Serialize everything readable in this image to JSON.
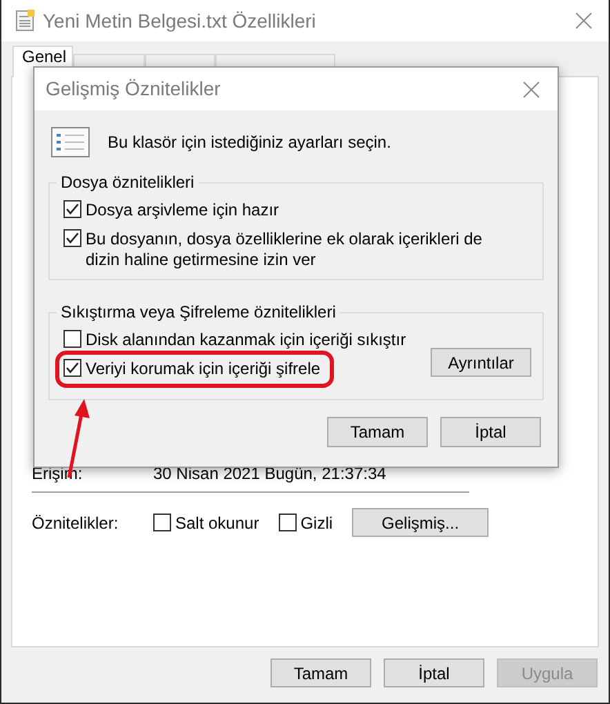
{
  "window": {
    "title": "Yeni Metin Belgesi.txt Özellikleri"
  },
  "tabs": [
    {
      "label": "Genel",
      "selected": true
    },
    {
      "selected": false
    },
    {
      "selected": false
    },
    {
      "selected": false
    }
  ],
  "general": {
    "rows": [
      {
        "label": "Erişim:",
        "value": "30 Nisan 2021 Bugün, 21:37:34"
      }
    ],
    "attributes": {
      "label": "Öznitelikler:",
      "checkboxes": [
        {
          "label": "Salt okunur",
          "checked": false
        },
        {
          "label": "Gizli",
          "checked": false
        }
      ],
      "advanced_button": "Gelişmiş..."
    }
  },
  "buttons": [
    {
      "label": "Tamam",
      "disabled": false
    },
    {
      "label": "İptal",
      "disabled": false
    },
    {
      "label": "Uygula",
      "disabled": true
    }
  ],
  "dialog": {
    "title": "Gelişmiş Öznitelikler",
    "intro": "Bu klasör için istediğiniz ayarları seçin.",
    "groups": [
      {
        "title": "Dosya öznitelikleri",
        "options": [
          {
            "label": "Dosya arşivleme için hazır",
            "checked": true
          },
          {
            "label": "Bu dosyanın, dosya özelliklerine ek olarak içerikleri de dizin haline getirmesine izin ver",
            "checked": true
          }
        ]
      },
      {
        "title": "Sıkıştırma veya Şifreleme öznitelikleri",
        "options": [
          {
            "label": "Disk alanından kazanmak için içeriği sıkıştır",
            "checked": false
          },
          {
            "label": "Veriyi korumak için içeriği şifrele",
            "checked": true,
            "highlighted": true
          }
        ],
        "details_button": "Ayrıntılar"
      }
    ],
    "buttons": [
      "Tamam",
      "İptal"
    ]
  }
}
